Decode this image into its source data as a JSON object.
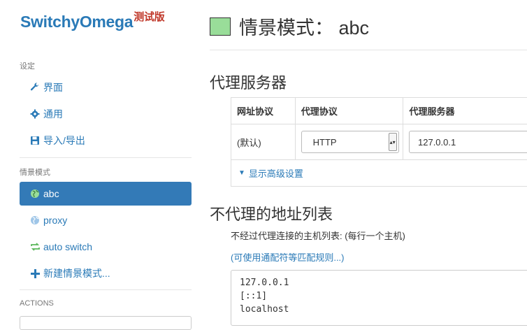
{
  "sidebar": {
    "logo": "SwitchyOmega",
    "logo_badge": "测试版",
    "settings_header": "设定",
    "settings_items": [
      {
        "label": "界面",
        "icon": "wrench-icon"
      },
      {
        "label": "通用",
        "icon": "gear-icon"
      },
      {
        "label": "导入/导出",
        "icon": "floppy-icon"
      }
    ],
    "profiles_header": "情景模式",
    "profile_items": [
      {
        "label": "abc",
        "icon": "globe-icon",
        "active": true
      },
      {
        "label": "proxy",
        "icon": "globe-icon",
        "active": false
      },
      {
        "label": "auto switch",
        "icon": "switch-icon",
        "active": false
      },
      {
        "label": "新建情景模式...",
        "icon": "plus-icon",
        "active": false
      }
    ],
    "actions_header": "ACTIONS"
  },
  "main": {
    "profile_color": "#99dd99",
    "title": "情景模式： abc",
    "proxy_section_title": "代理服务器",
    "table": {
      "headers": [
        "网址协议",
        "代理协议",
        "代理服务器"
      ],
      "row": {
        "scheme": "(默认)",
        "protocol": "HTTP",
        "server": "127.0.0.1"
      }
    },
    "advanced_label": "显示高级设置",
    "bypass_section_title": "不代理的地址列表",
    "bypass_desc": "不经过代理连接的主机列表: (每行一个主机)",
    "wildcard_link": "(可使用通配符等匹配规则...)",
    "bypass_list": [
      "127.0.0.1",
      "[::1]",
      "localhost"
    ]
  },
  "colors": {
    "accent": "#337ab7",
    "link": "#2a7ab7",
    "badge": "#c0392b"
  }
}
